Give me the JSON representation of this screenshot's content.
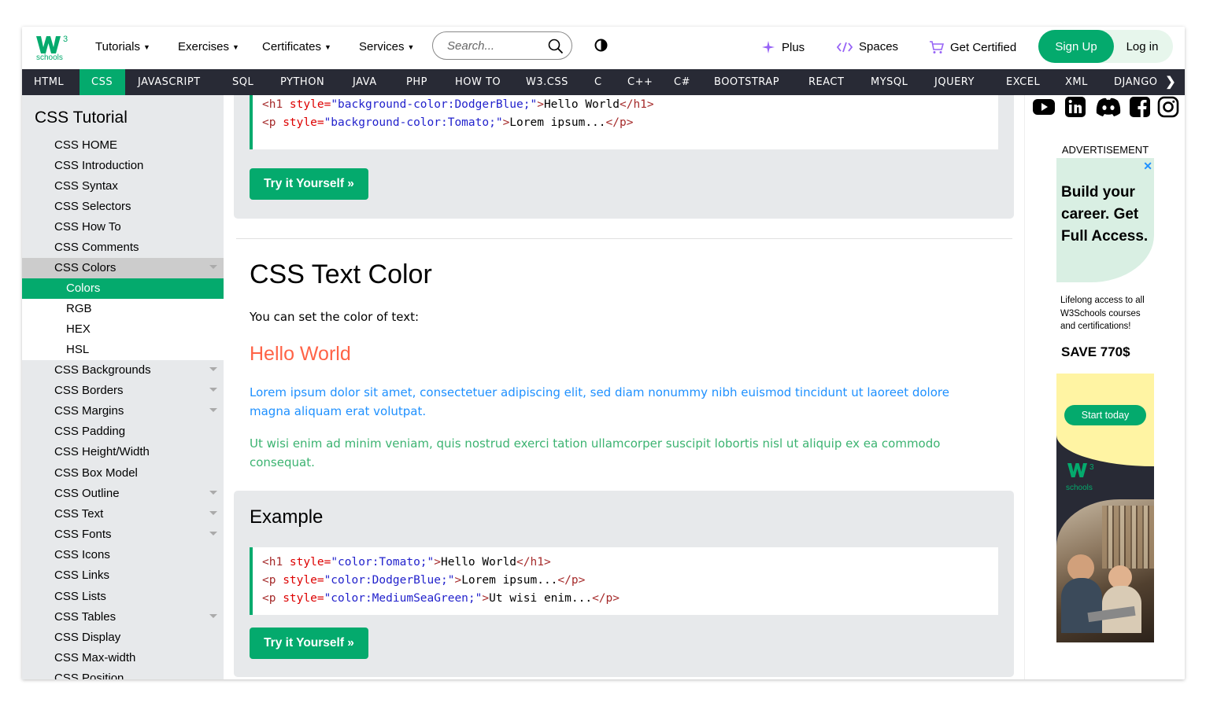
{
  "topbar": {
    "logo_text": "schools",
    "menus": [
      {
        "label": "Tutorials"
      },
      {
        "label": "Exercises"
      },
      {
        "label": "Certificates"
      },
      {
        "label": "Services"
      }
    ],
    "search_placeholder": "Search...",
    "plus_label": "Plus",
    "spaces_label": "Spaces",
    "certified_label": "Get Certified",
    "signup_label": "Sign Up",
    "login_label": "Log in"
  },
  "nav": {
    "items": [
      "HTML",
      "CSS",
      "JAVASCRIPT",
      "SQL",
      "PYTHON",
      "JAVA",
      "PHP",
      "HOW TO",
      "W3.CSS",
      "C",
      "C++",
      "C#",
      "BOOTSTRAP",
      "REACT",
      "MYSQL",
      "JQUERY",
      "EXCEL",
      "XML",
      "DJANGO"
    ],
    "active": "CSS"
  },
  "sidebar": {
    "title": "CSS Tutorial",
    "items": [
      {
        "label": "CSS HOME"
      },
      {
        "label": "CSS Introduction"
      },
      {
        "label": "CSS Syntax"
      },
      {
        "label": "CSS Selectors"
      },
      {
        "label": "CSS How To"
      },
      {
        "label": "CSS Comments"
      },
      {
        "label": "CSS Colors"
      },
      {
        "label": "Colors"
      },
      {
        "label": "RGB"
      },
      {
        "label": "HEX"
      },
      {
        "label": "HSL"
      },
      {
        "label": "CSS Backgrounds"
      },
      {
        "label": "CSS Borders"
      },
      {
        "label": "CSS Margins"
      },
      {
        "label": "CSS Padding"
      },
      {
        "label": "CSS Height/Width"
      },
      {
        "label": "CSS Box Model"
      },
      {
        "label": "CSS Outline"
      },
      {
        "label": "CSS Text"
      },
      {
        "label": "CSS Fonts"
      },
      {
        "label": "CSS Icons"
      },
      {
        "label": "CSS Links"
      },
      {
        "label": "CSS Lists"
      },
      {
        "label": "CSS Tables"
      },
      {
        "label": "CSS Display"
      },
      {
        "label": "CSS Max-width"
      },
      {
        "label": "CSS Position"
      }
    ]
  },
  "main": {
    "example1": {
      "line1": {
        "open": "<h1",
        "attr": " style=",
        "value": "\"background-color:DodgerBlue;\"",
        "close": ">",
        "text": "Hello World",
        "end": "</h1>"
      },
      "line2": {
        "open": "<p",
        "attr": " style=",
        "value": "\"background-color:Tomato;\"",
        "close": ">",
        "text": "Lorem ipsum...",
        "end": "</p>"
      },
      "button": "Try it Yourself »"
    },
    "section_title": "CSS Text Color",
    "intro": "You can set the color of text:",
    "hello": "Hello World",
    "lorem": "Lorem ipsum dolor sit amet, consectetuer adipiscing elit, sed diam nonummy nibh euismod tincidunt ut laoreet dolore magna aliquam erat volutpat.",
    "ut_wisi": "Ut wisi enim ad minim veniam, quis nostrud exerci tation ullamcorper suscipit lobortis nisl ut aliquip ex ea commodo consequat.",
    "example2": {
      "title": "Example",
      "line1": {
        "open": "<h1",
        "attr": " style=",
        "value": "\"color:Tomato;\"",
        "close": ">",
        "text": "Hello World",
        "end": "</h1>"
      },
      "line2": {
        "open": "<p",
        "attr": " style=",
        "value": "\"color:DodgerBlue;\"",
        "close": ">",
        "text": "Lorem ipsum...",
        "end": "</p>"
      },
      "line3": {
        "open": "<p",
        "attr": " style=",
        "value": "\"color:MediumSeaGreen;\"",
        "close": ">",
        "text": "Ut wisi enim...",
        "end": "</p>"
      },
      "button": "Try it Yourself »"
    }
  },
  "right": {
    "ad_label": "ADVERTISEMENT",
    "ad_close": "✕",
    "ad_headline": "Build your career. Get Full Access.",
    "ad_sub": "Lifelong access to all W3Schools courses and certifications!",
    "ad_save": "SAVE 770$",
    "ad_button": "Start today",
    "ad_logo_text": "schools"
  },
  "colors": {
    "brand_green": "#04aa6d",
    "nav_dark": "#282a35",
    "sidebar_bg": "#e7e9eb",
    "tomato": "#ff6347",
    "dodgerblue": "#1e90ff",
    "mediumseagreen": "#3cb371"
  },
  "icons": [
    "w3schools-logo",
    "search-icon",
    "contrast-icon",
    "sparkle-icon",
    "code-icon",
    "cart-icon",
    "youtube-icon",
    "linkedin-icon",
    "discord-icon",
    "facebook-icon",
    "instagram-icon"
  ]
}
